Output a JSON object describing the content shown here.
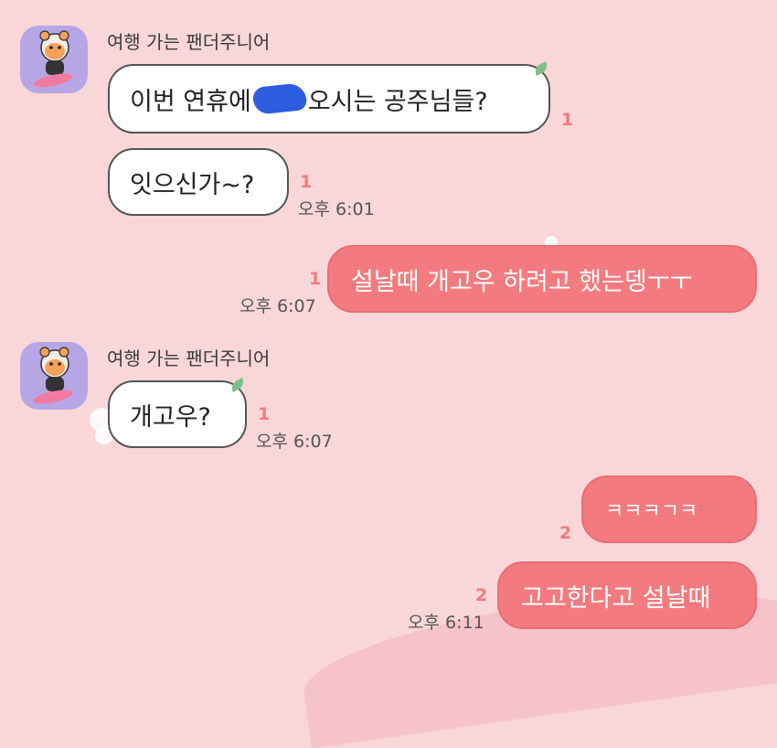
{
  "chat": {
    "sender_name": "여행 가는 팬더주니어",
    "messages": [
      {
        "text_before": "이번 연휴에",
        "text_after": "오시는 공주님들?",
        "unread": "1"
      },
      {
        "text": "잇으신가~?",
        "unread": "1",
        "time": "오후 6:01"
      },
      {
        "text": "설날때 개고우 하려고 했는뎅ㅜㅜ",
        "unread": "1",
        "time": "오후 6:07"
      },
      {
        "text": "개고우?",
        "unread": "1",
        "time": "오후 6:07"
      },
      {
        "text": "ㅋㅋㅋㄱㅋ",
        "unread": "2"
      },
      {
        "text": "고고한다고 설날때",
        "unread": "2",
        "time": "오후 6:11"
      }
    ]
  },
  "colors": {
    "background": "#f9d6d8",
    "outgoing_bubble": "#f37b7f",
    "incoming_bubble": "#ffffff",
    "unread_count": "#f07b7e"
  },
  "icons": {
    "avatar": "panda-character-avatar",
    "bubble_leaf": "leaf-icon",
    "redaction": "redaction-scribble"
  }
}
